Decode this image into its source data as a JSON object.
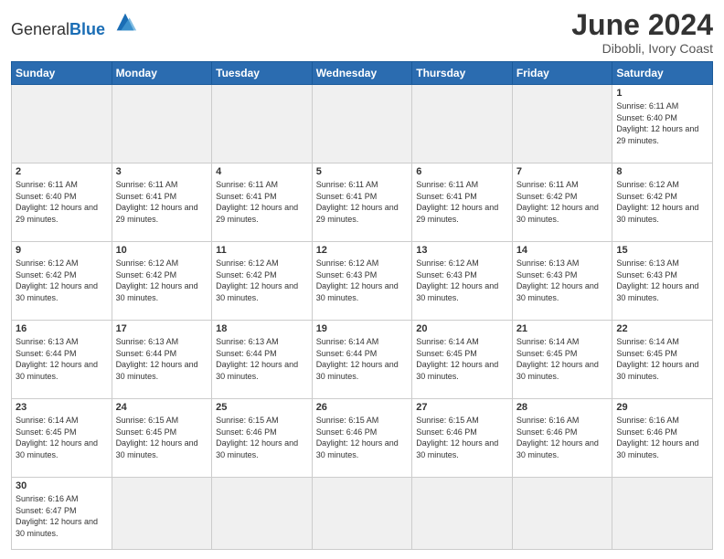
{
  "header": {
    "logo_general": "General",
    "logo_blue": "Blue",
    "month_title": "June 2024",
    "location": "Dibobli, Ivory Coast"
  },
  "weekdays": [
    "Sunday",
    "Monday",
    "Tuesday",
    "Wednesday",
    "Thursday",
    "Friday",
    "Saturday"
  ],
  "weeks": [
    [
      {
        "day": "",
        "empty": true
      },
      {
        "day": "",
        "empty": true
      },
      {
        "day": "",
        "empty": true
      },
      {
        "day": "",
        "empty": true
      },
      {
        "day": "",
        "empty": true
      },
      {
        "day": "",
        "empty": true
      },
      {
        "day": "1",
        "sunrise": "6:11 AM",
        "sunset": "6:40 PM",
        "daylight": "12 hours and 29 minutes."
      }
    ],
    [
      {
        "day": "2",
        "sunrise": "6:11 AM",
        "sunset": "6:40 PM",
        "daylight": "12 hours and 29 minutes."
      },
      {
        "day": "3",
        "sunrise": "6:11 AM",
        "sunset": "6:41 PM",
        "daylight": "12 hours and 29 minutes."
      },
      {
        "day": "4",
        "sunrise": "6:11 AM",
        "sunset": "6:41 PM",
        "daylight": "12 hours and 29 minutes."
      },
      {
        "day": "5",
        "sunrise": "6:11 AM",
        "sunset": "6:41 PM",
        "daylight": "12 hours and 29 minutes."
      },
      {
        "day": "6",
        "sunrise": "6:11 AM",
        "sunset": "6:41 PM",
        "daylight": "12 hours and 29 minutes."
      },
      {
        "day": "7",
        "sunrise": "6:11 AM",
        "sunset": "6:42 PM",
        "daylight": "12 hours and 30 minutes."
      },
      {
        "day": "8",
        "sunrise": "6:12 AM",
        "sunset": "6:42 PM",
        "daylight": "12 hours and 30 minutes."
      }
    ],
    [
      {
        "day": "9",
        "sunrise": "6:12 AM",
        "sunset": "6:42 PM",
        "daylight": "12 hours and 30 minutes."
      },
      {
        "day": "10",
        "sunrise": "6:12 AM",
        "sunset": "6:42 PM",
        "daylight": "12 hours and 30 minutes."
      },
      {
        "day": "11",
        "sunrise": "6:12 AM",
        "sunset": "6:42 PM",
        "daylight": "12 hours and 30 minutes."
      },
      {
        "day": "12",
        "sunrise": "6:12 AM",
        "sunset": "6:43 PM",
        "daylight": "12 hours and 30 minutes."
      },
      {
        "day": "13",
        "sunrise": "6:12 AM",
        "sunset": "6:43 PM",
        "daylight": "12 hours and 30 minutes."
      },
      {
        "day": "14",
        "sunrise": "6:13 AM",
        "sunset": "6:43 PM",
        "daylight": "12 hours and 30 minutes."
      },
      {
        "day": "15",
        "sunrise": "6:13 AM",
        "sunset": "6:43 PM",
        "daylight": "12 hours and 30 minutes."
      }
    ],
    [
      {
        "day": "16",
        "sunrise": "6:13 AM",
        "sunset": "6:44 PM",
        "daylight": "12 hours and 30 minutes."
      },
      {
        "day": "17",
        "sunrise": "6:13 AM",
        "sunset": "6:44 PM",
        "daylight": "12 hours and 30 minutes."
      },
      {
        "day": "18",
        "sunrise": "6:13 AM",
        "sunset": "6:44 PM",
        "daylight": "12 hours and 30 minutes."
      },
      {
        "day": "19",
        "sunrise": "6:14 AM",
        "sunset": "6:44 PM",
        "daylight": "12 hours and 30 minutes."
      },
      {
        "day": "20",
        "sunrise": "6:14 AM",
        "sunset": "6:45 PM",
        "daylight": "12 hours and 30 minutes."
      },
      {
        "day": "21",
        "sunrise": "6:14 AM",
        "sunset": "6:45 PM",
        "daylight": "12 hours and 30 minutes."
      },
      {
        "day": "22",
        "sunrise": "6:14 AM",
        "sunset": "6:45 PM",
        "daylight": "12 hours and 30 minutes."
      }
    ],
    [
      {
        "day": "23",
        "sunrise": "6:14 AM",
        "sunset": "6:45 PM",
        "daylight": "12 hours and 30 minutes."
      },
      {
        "day": "24",
        "sunrise": "6:15 AM",
        "sunset": "6:45 PM",
        "daylight": "12 hours and 30 minutes."
      },
      {
        "day": "25",
        "sunrise": "6:15 AM",
        "sunset": "6:46 PM",
        "daylight": "12 hours and 30 minutes."
      },
      {
        "day": "26",
        "sunrise": "6:15 AM",
        "sunset": "6:46 PM",
        "daylight": "12 hours and 30 minutes."
      },
      {
        "day": "27",
        "sunrise": "6:15 AM",
        "sunset": "6:46 PM",
        "daylight": "12 hours and 30 minutes."
      },
      {
        "day": "28",
        "sunrise": "6:16 AM",
        "sunset": "6:46 PM",
        "daylight": "12 hours and 30 minutes."
      },
      {
        "day": "29",
        "sunrise": "6:16 AM",
        "sunset": "6:46 PM",
        "daylight": "12 hours and 30 minutes."
      }
    ],
    [
      {
        "day": "30",
        "sunrise": "6:16 AM",
        "sunset": "6:47 PM",
        "daylight": "12 hours and 30 minutes."
      },
      {
        "day": "",
        "empty": true
      },
      {
        "day": "",
        "empty": true
      },
      {
        "day": "",
        "empty": true
      },
      {
        "day": "",
        "empty": true
      },
      {
        "day": "",
        "empty": true
      },
      {
        "day": "",
        "empty": true
      }
    ]
  ]
}
